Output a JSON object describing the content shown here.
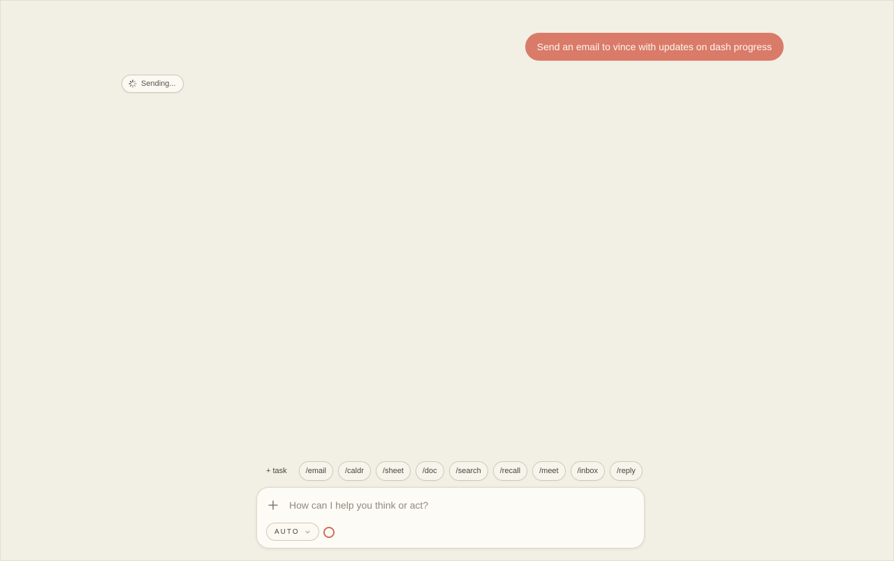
{
  "conversation": {
    "user_message": "Send an email to vince with updates on dash progress",
    "status": {
      "label": "Sending...",
      "icon": "spinner-icon"
    }
  },
  "quick_actions": [
    {
      "label": "+ task"
    },
    {
      "label": "/email"
    },
    {
      "label": "/caldr"
    },
    {
      "label": "/sheet"
    },
    {
      "label": "/doc"
    },
    {
      "label": "/search"
    },
    {
      "label": "/recall"
    },
    {
      "label": "/meet"
    },
    {
      "label": "/inbox"
    },
    {
      "label": "/reply"
    }
  ],
  "composer": {
    "placeholder": "How can I help you think or act?",
    "value": "",
    "add_icon": "plus-icon",
    "mode": {
      "selected": "AUTO",
      "icon": "chevron-down-icon"
    },
    "record_icon": "record-circle-icon"
  },
  "colors": {
    "background": "#f2efe4",
    "accent": "#d97b68",
    "record": "#cf6d58"
  }
}
